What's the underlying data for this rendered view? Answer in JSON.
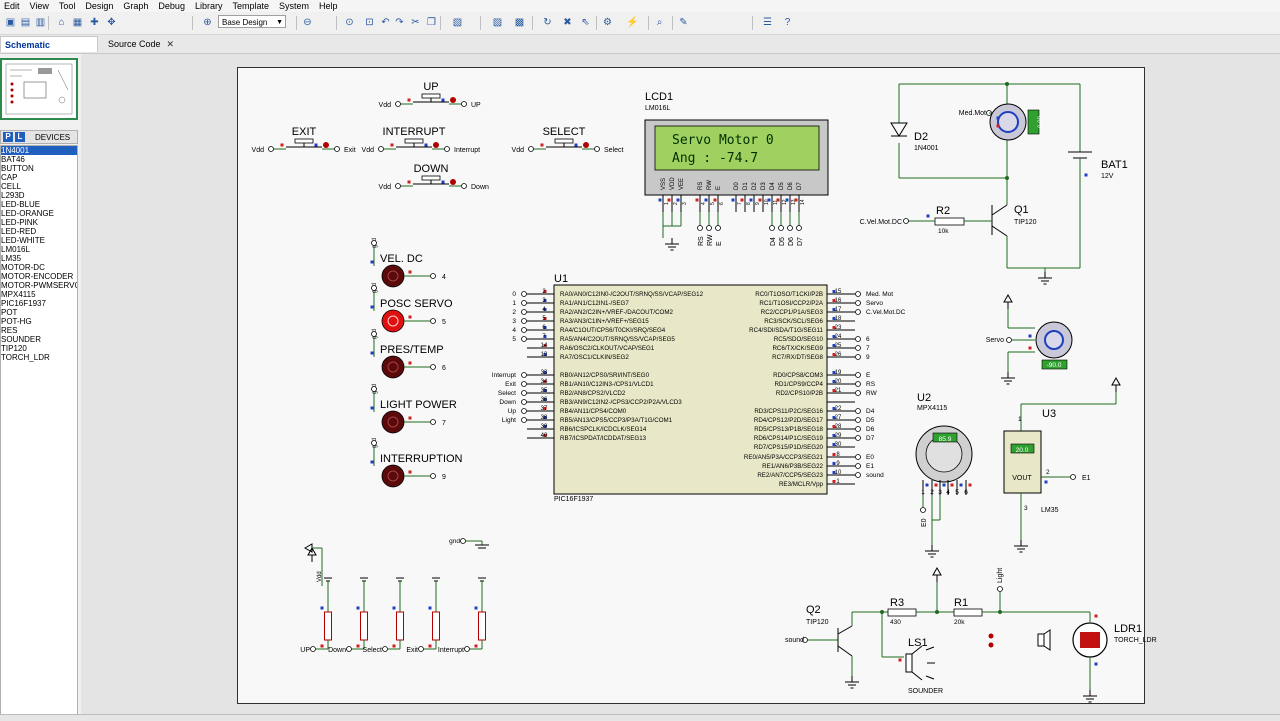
{
  "menu": [
    "Edit",
    "View",
    "Tool",
    "Design",
    "Graph",
    "Debug",
    "Library",
    "Template",
    "System",
    "Help"
  ],
  "toolbar": {
    "layer_select": "Base Design",
    "icons": [
      "save-icon",
      "open-icon",
      "print-icon",
      "home-icon",
      "grid-icon",
      "origin-icon",
      "pan-icon",
      "zoom-in-icon",
      "zoom-out-icon",
      "zoom-all-icon",
      "zoom-area-icon",
      "undo-icon",
      "redo-icon",
      "cut-icon",
      "copy-icon",
      "paste-icon",
      "block-copy-icon",
      "block-move-icon",
      "block-rotate-icon",
      "block-delete-icon",
      "pick-icon",
      "make-device-icon",
      "wire-autorouter-icon",
      "search-icon",
      "property-icon",
      "bom-icon",
      "help-icon"
    ]
  },
  "tabs": [
    {
      "label": "Schematic Capture",
      "close": "✕"
    },
    {
      "label": "Source Code",
      "close": "✕"
    }
  ],
  "devices_panel": {
    "p_button": "P",
    "l_button": "L",
    "title": "DEVICES",
    "items": [
      "1N4001",
      "BAT46",
      "BUTTON",
      "CAP",
      "CELL",
      "L293D",
      "LED-BLUE",
      "LED-ORANGE",
      "LED-PINK",
      "LED-RED",
      "LED-WHITE",
      "LM016L",
      "LM35",
      "MOTOR-DC",
      "MOTOR-ENCODER",
      "MOTOR-PWMSERVO",
      "MPX4115",
      "PIC16F1937",
      "POT",
      "POT-HG",
      "RES",
      "SOUNDER",
      "TIP120",
      "TORCH_LDR"
    ],
    "selected": 0
  },
  "schematic": {
    "buttons": {
      "up": {
        "title": "UP",
        "left": "Vdd",
        "right": "UP"
      },
      "exit": {
        "title": "EXIT",
        "left": "Vdd",
        "right": "Exit"
      },
      "interrupt": {
        "title": "INTERRUPT",
        "left": "Vdd",
        "right": "Interrupt"
      },
      "select": {
        "title": "SELECT",
        "left": "Vdd",
        "right": "Select"
      },
      "down": {
        "title": "DOWN",
        "left": "Vdd",
        "right": "Down"
      }
    },
    "lcd": {
      "ref": "LCD1",
      "part": "LM016L",
      "line1": "Servo Motor 0",
      "line2": "Ang : -74.7",
      "pins": [
        "VSS",
        "VDD",
        "VEE",
        "RS",
        "RW",
        "E",
        "D0",
        "D1",
        "D2",
        "D3",
        "D4",
        "D5",
        "D6",
        "D7"
      ],
      "pin_nums": [
        "1",
        "2",
        "3",
        "4",
        "5",
        "6",
        "7",
        "8",
        "9",
        "10",
        "11",
        "12",
        "13",
        "14"
      ],
      "bottom_labels": [
        "RS",
        "RW",
        "E",
        "D4",
        "D5",
        "D6",
        "D7"
      ]
    },
    "leds": [
      {
        "gnd": "gnd",
        "title": "VEL. DC",
        "pin": "4",
        "lit": false
      },
      {
        "gnd": "gnd",
        "title": "POSC SERVO",
        "pin": "5",
        "lit": true
      },
      {
        "gnd": "gnd",
        "title": "PRES/TEMP",
        "pin": "6",
        "lit": false
      },
      {
        "gnd": "gnd",
        "title": "LIGHT POWER",
        "pin": "7",
        "lit": false
      },
      {
        "gnd": "gnd",
        "title": "INTERRUPTION",
        "pin": "9",
        "lit": false
      }
    ],
    "mcu": {
      "ref": "U1",
      "part": "PIC16F1937",
      "left": [
        {
          "net": "0",
          "num": "2",
          "name": "RA0/AN0/C12IN0-/C2OUT/SRNQ/SS/VCAP/SEG12"
        },
        {
          "net": "1",
          "num": "3",
          "name": "RA1/AN1/C12IN1-/SEG7"
        },
        {
          "net": "2",
          "num": "4",
          "name": "RA2/AN2/C2IN+/VREF-/DACOUT/COM2"
        },
        {
          "net": "3",
          "num": "5",
          "name": "RA3/AN3/C1IN+/VREF+/SEG15"
        },
        {
          "net": "4",
          "num": "6",
          "name": "RA4/C1OUT/CPS6/T0CKI/SRQ/SEG4"
        },
        {
          "net": "5",
          "num": "7",
          "name": "RA5/AN4/C2OUT/SRNQ/SS/VCAP/SEG5"
        },
        {
          "net": "",
          "num": "14",
          "name": "RA6/OSC2/CLKOUT/VCAP/SEG1"
        },
        {
          "net": "",
          "num": "13",
          "name": "RA7/OSC1/CLKIN/SEG2"
        },
        {
          "net": "Interrupt",
          "num": "33",
          "name": "RB0/AN12/CPS0/SRI/INT/SEG0"
        },
        {
          "net": "Exit",
          "num": "34",
          "name": "RB1/AN10/C12IN3-/CPS1/VLCD1"
        },
        {
          "net": "Select",
          "num": "35",
          "name": "RB2/AN8/CPS2/VLCD2"
        },
        {
          "net": "Down",
          "num": "36",
          "name": "RB3/AN9/C12IN2-/CPS3/CCP2/P2A/VLCD3"
        },
        {
          "net": "Up",
          "num": "37",
          "name": "RB4/AN11/CPS4/COM0"
        },
        {
          "net": "Light",
          "num": "38",
          "name": "RB5/AN13/CPS5/CCP3/P3A/T1G/COM1"
        },
        {
          "net": "",
          "num": "39",
          "name": "RB6/ICSPCLK/ICDCLK/SEG14"
        },
        {
          "net": "",
          "num": "40",
          "name": "RB7/ICSPDAT/ICDDAT/SEG13"
        }
      ],
      "right": [
        {
          "net": "Med. Mot",
          "num": "15",
          "name": "RC0/T1OSO/T1CKI/P2B"
        },
        {
          "net": "Servo",
          "num": "16",
          "name": "RC1/T1OSI/CCP2/P2A"
        },
        {
          "net": "C.Vel.Mot.DC",
          "num": "17",
          "name": "RC2/CCP1/P1A/SEG3"
        },
        {
          "net": "",
          "num": "18",
          "name": "RC3/SCK/SCL/SEG6"
        },
        {
          "net": "",
          "num": "23",
          "name": "RC4/SDI/SDA/T1G/SEG11"
        },
        {
          "net": "6",
          "num": "24",
          "name": "RC5/SDO/SEG10"
        },
        {
          "net": "7",
          "num": "25",
          "name": "RC6/TX/CK/SEG9"
        },
        {
          "net": "9",
          "num": "26",
          "name": "RC7/RX/DT/SEG8"
        },
        {
          "net": "E",
          "num": "19",
          "name": "RD0/CPS8/COM3"
        },
        {
          "net": "RS",
          "num": "20",
          "name": "RD1/CPS9/CCP4"
        },
        {
          "net": "RW",
          "num": "21",
          "name": "RD2/CPS10/P2B"
        },
        {
          "net": "D4",
          "num": "22",
          "name": "RD3/CPS11/P2C/SEG16"
        },
        {
          "net": "D5",
          "num": "27",
          "name": "RD4/CPS12/P2D/SEG17"
        },
        {
          "net": "D6",
          "num": "28",
          "name": "RD5/CPS13/P1B/SEG18"
        },
        {
          "net": "D7",
          "num": "29",
          "name": "RD6/CPS14/P1C/SEG19"
        },
        {
          "net": "",
          "num": "30",
          "name": "RD7/CPS15/P1D/SEG20"
        },
        {
          "net": "E0",
          "num": "8",
          "name": "RE0/AN5/P3A/CCP3/SEG21"
        },
        {
          "net": "E1",
          "num": "9",
          "name": "RE1/AN6/P3B/SEG22"
        },
        {
          "net": "sound",
          "num": "10",
          "name": "RE2/AN7/CCP5/SEG23"
        },
        {
          "net": "",
          "num": "1",
          "name": "RE3/MCLR/Vpp"
        }
      ]
    },
    "motor": {
      "net": "Med.Mot",
      "reading": "0.00"
    },
    "diode": {
      "ref": "D2",
      "part": "1N4001"
    },
    "battery": {
      "ref": "BAT1",
      "value": "12V"
    },
    "q1": {
      "ref": "Q1",
      "part": "TIP120",
      "net": "C.Vel.Mot.DC"
    },
    "r2": {
      "ref": "R2",
      "value": "10k"
    },
    "servo": {
      "net": "Servo",
      "reading": "-90.0"
    },
    "u2": {
      "ref": "U2",
      "part": "MPX4115",
      "reading": "85.9",
      "net": "E0",
      "pins": [
        "1",
        "2",
        "3",
        "4",
        "5",
        "6"
      ]
    },
    "u3": {
      "ref": "U3",
      "part": "LM35",
      "reading": "20.0",
      "vout": "VOUT",
      "pin1": "1",
      "pin2": "2",
      "pin3": "3",
      "net": "E1"
    },
    "pulldowns": {
      "vdd": "Vdd",
      "gnd": "gnd",
      "labels": [
        "UP",
        "Down",
        "Select",
        "Exit",
        "Interrupt"
      ]
    },
    "q2": {
      "ref": "Q2",
      "part": "TIP120",
      "net": "sound"
    },
    "r3": {
      "ref": "R3",
      "value": "430"
    },
    "r1": {
      "ref": "R1",
      "value": "20k"
    },
    "light_net": "Light",
    "ls1": {
      "ref": "LS1",
      "part": "SOUNDER"
    },
    "ldr": {
      "ref": "LDR1",
      "part": "TORCH_LDR"
    }
  }
}
